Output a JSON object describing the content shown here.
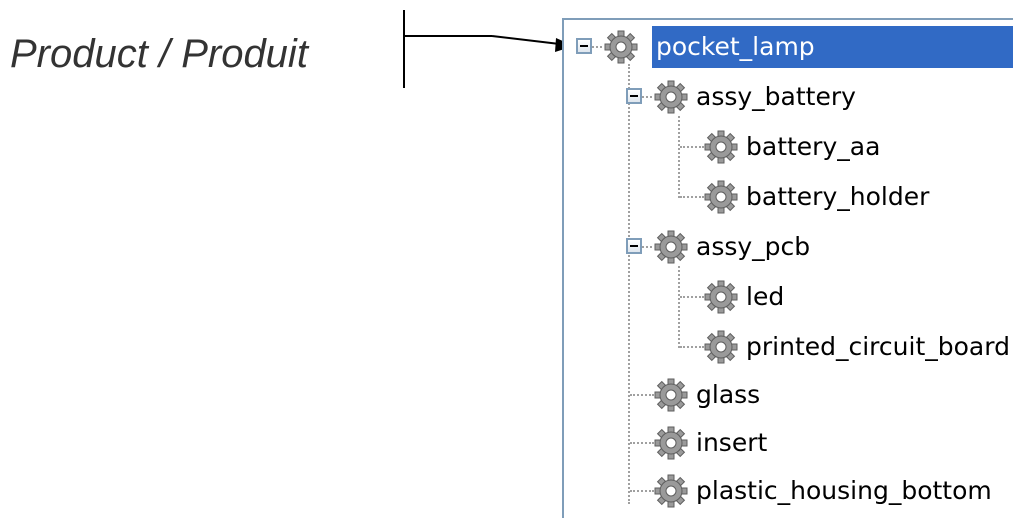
{
  "caption": "Product / Produit",
  "tree": {
    "root": {
      "label": "pocket_lamp",
      "selected": true,
      "expanded": true
    },
    "nodes": [
      {
        "label": "assy_battery",
        "expanded": true
      },
      {
        "label": "battery_aa"
      },
      {
        "label": "battery_holder"
      },
      {
        "label": "assy_pcb",
        "expanded": true
      },
      {
        "label": "led"
      },
      {
        "label": "printed_circuit_board"
      },
      {
        "label": "glass"
      },
      {
        "label": "insert"
      },
      {
        "label": "plastic_housing_bottom"
      }
    ]
  },
  "colors": {
    "selection": "#316ac5",
    "border": "#7f9db9",
    "gear": "#9a9a9a"
  },
  "icons": {
    "node_icon": "gear-icon",
    "toggle_icon": "collapse-minus-icon"
  }
}
